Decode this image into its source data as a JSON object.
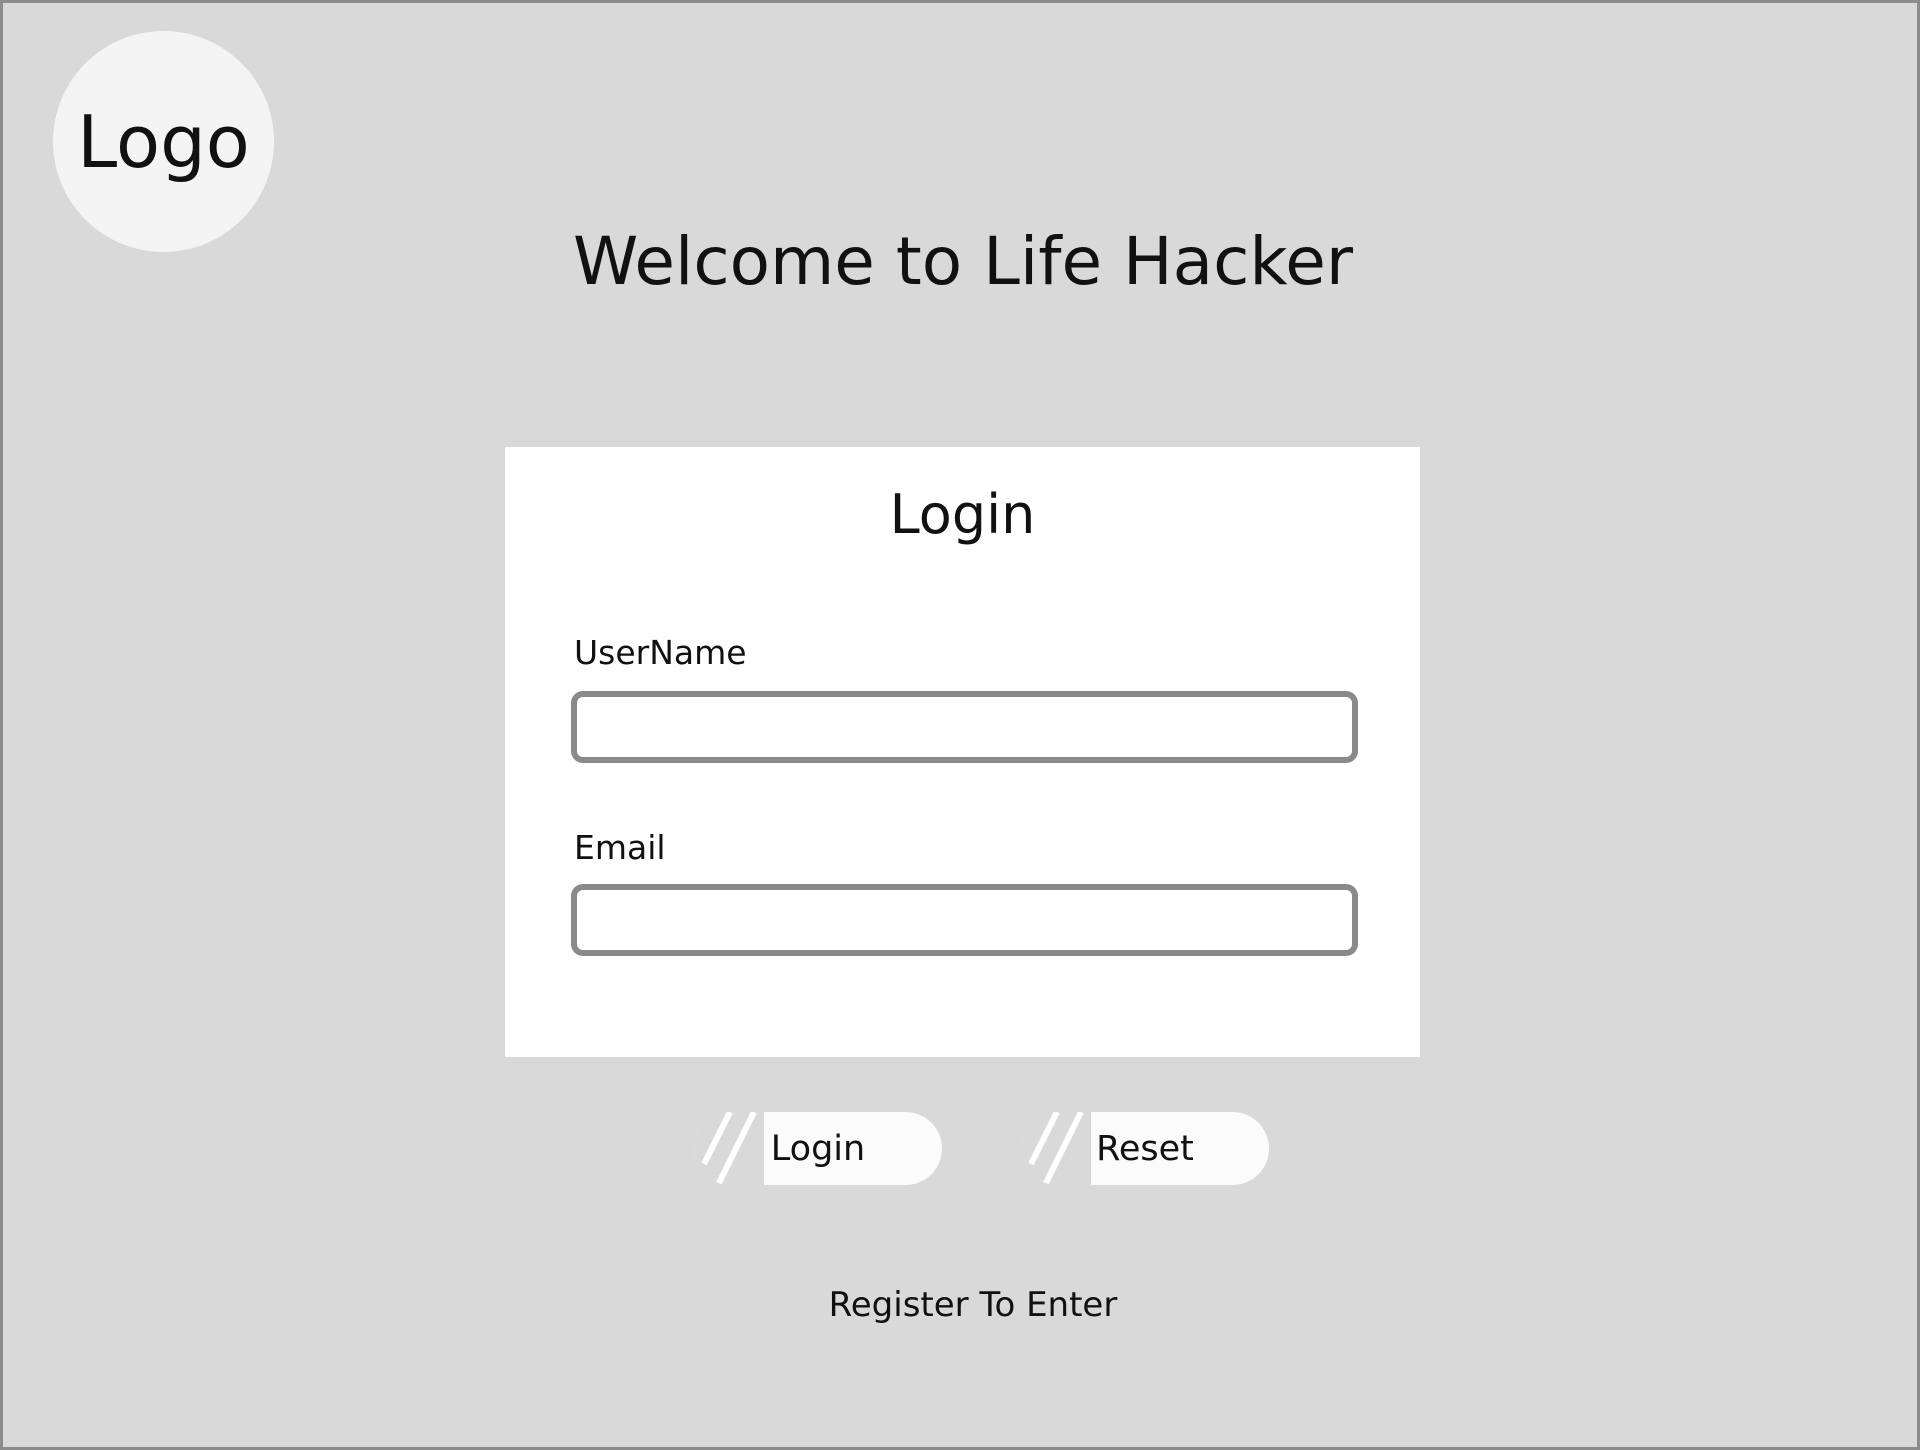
{
  "logo": {
    "text": "Logo"
  },
  "header": {
    "title": "Welcome to Life Hacker"
  },
  "login_form": {
    "title": "Login",
    "username": {
      "label": "UserName",
      "value": "",
      "placeholder": ""
    },
    "email": {
      "label": "Email",
      "value": "",
      "placeholder": ""
    }
  },
  "actions": {
    "login_label": "Login",
    "reset_label": "Reset"
  },
  "footer": {
    "register_link": "Register To Enter"
  },
  "colors": {
    "background": "#d9d9d9",
    "card": "#ffffff",
    "input_border": "#8a8a8a",
    "button": "#fbfbfb",
    "text": "#111111"
  }
}
